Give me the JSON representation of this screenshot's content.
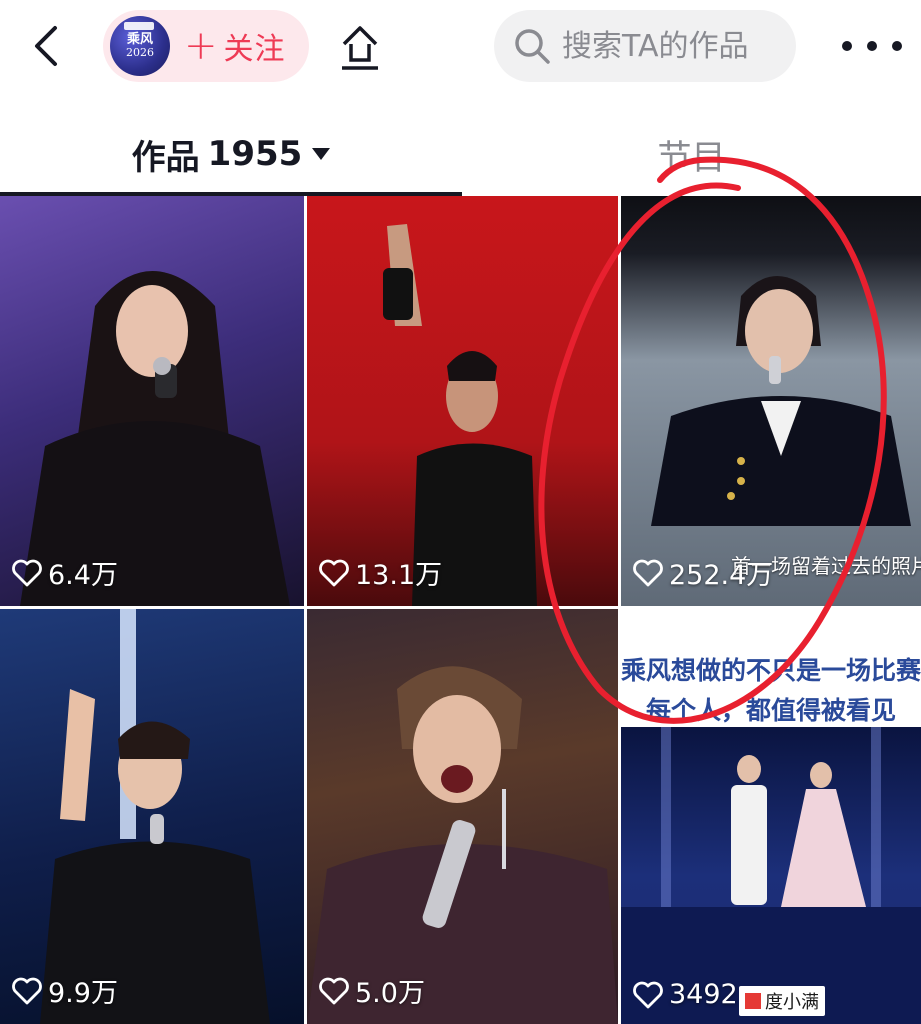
{
  "header": {
    "back_icon": "chevron-left-icon",
    "avatar_text": "乘风",
    "avatar_year": "2026",
    "follow_label": "关注",
    "share_icon": "share-up-icon",
    "search_placeholder": "搜索TA的作品",
    "more_icon": "more-dots-icon"
  },
  "tabs": {
    "works_label": "作品",
    "works_count": "1955",
    "program_label": "节目"
  },
  "videos": [
    {
      "likes": "6.4万"
    },
    {
      "likes": "13.1万"
    },
    {
      "likes": "252.4万",
      "caption": "首一场留着过去的照片"
    },
    {
      "likes": "9.9万"
    },
    {
      "likes": "5.0万"
    },
    {
      "likes": "3492",
      "headline_1": "乘风想做的不只是一场比赛",
      "headline_2": "每个人，都值得被看见",
      "sponsor": "度小满"
    }
  ],
  "colors": {
    "accent": "#ee3a55",
    "annotation": "#e8202f",
    "text_primary": "#161823",
    "text_secondary": "#8a8b91"
  }
}
